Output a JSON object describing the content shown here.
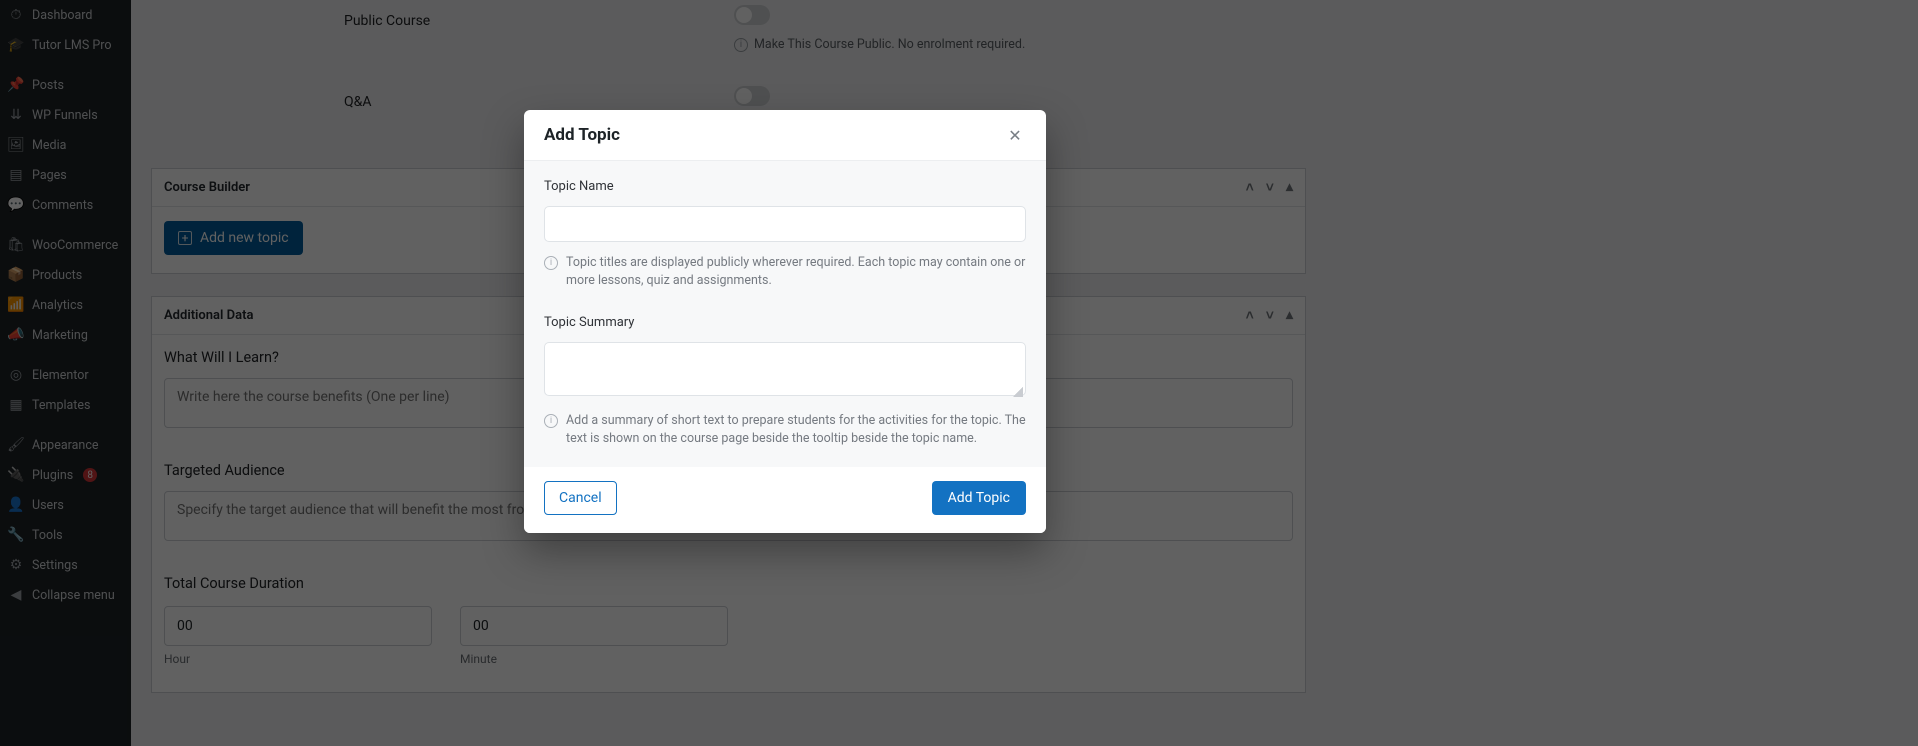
{
  "sidebar": {
    "items": [
      {
        "icon": "gauge-icon",
        "glyph": "⏱",
        "label": "Dashboard"
      },
      {
        "icon": "cap-icon",
        "glyph": "🎓",
        "label": "Tutor LMS Pro"
      },
      {
        "icon": "pin-icon",
        "glyph": "📌",
        "label": "Posts"
      },
      {
        "icon": "funnel-icon",
        "glyph": "⇊",
        "label": "WP Funnels"
      },
      {
        "icon": "media-icon",
        "glyph": "🖼",
        "label": "Media"
      },
      {
        "icon": "pages-icon",
        "glyph": "▤",
        "label": "Pages"
      },
      {
        "icon": "comments-icon",
        "glyph": "💬",
        "label": "Comments"
      },
      {
        "icon": "woocommerce-icon",
        "glyph": "🛍",
        "label": "WooCommerce"
      },
      {
        "icon": "products-icon",
        "glyph": "📦",
        "label": "Products"
      },
      {
        "icon": "analytics-icon",
        "glyph": "📶",
        "label": "Analytics"
      },
      {
        "icon": "marketing-icon",
        "glyph": "📣",
        "label": "Marketing"
      },
      {
        "icon": "elementor-icon",
        "glyph": "◎",
        "label": "Elementor"
      },
      {
        "icon": "templates-icon",
        "glyph": "▦",
        "label": "Templates"
      },
      {
        "icon": "appearance-icon",
        "glyph": "🖌",
        "label": "Appearance"
      },
      {
        "icon": "plugins-icon",
        "glyph": "🔌",
        "label": "Plugins",
        "badge": "8"
      },
      {
        "icon": "users-icon",
        "glyph": "👤",
        "label": "Users"
      },
      {
        "icon": "tools-icon",
        "glyph": "🔧",
        "label": "Tools"
      },
      {
        "icon": "settings-icon",
        "glyph": "⚙",
        "label": "Settings"
      },
      {
        "icon": "collapse-icon",
        "glyph": "◀",
        "label": "Collapse menu"
      }
    ]
  },
  "settings": {
    "public_course_label": "Public Course",
    "public_course_hint": "Make This Course Public. No enrolment required.",
    "qa_label": "Q&A"
  },
  "course_builder": {
    "title": "Course Builder",
    "add_topic_btn": "Add new topic"
  },
  "additional_data": {
    "title": "Additional Data",
    "what_learn_label": "What Will I Learn?",
    "what_learn_placeholder": "Write here the course benefits (One per line)",
    "audience_label": "Targeted Audience",
    "audience_placeholder": "Specify the target audience that will benefit the most from ",
    "duration_label": "Total Course Duration",
    "hour_value": "00",
    "hour_label": "Hour",
    "minute_value": "00",
    "minute_label": "Minute"
  },
  "modal": {
    "title": "Add Topic",
    "name_label": "Topic Name",
    "name_hint": "Topic titles are displayed publicly wherever required. Each topic may contain one or more lessons, quiz and assignments.",
    "summary_label": "Topic Summary",
    "summary_hint": "Add a summary of short text to prepare students for the activities for the topic. The text is shown on the course page beside the tooltip beside the topic name.",
    "cancel_label": "Cancel",
    "submit_label": "Add Topic"
  }
}
